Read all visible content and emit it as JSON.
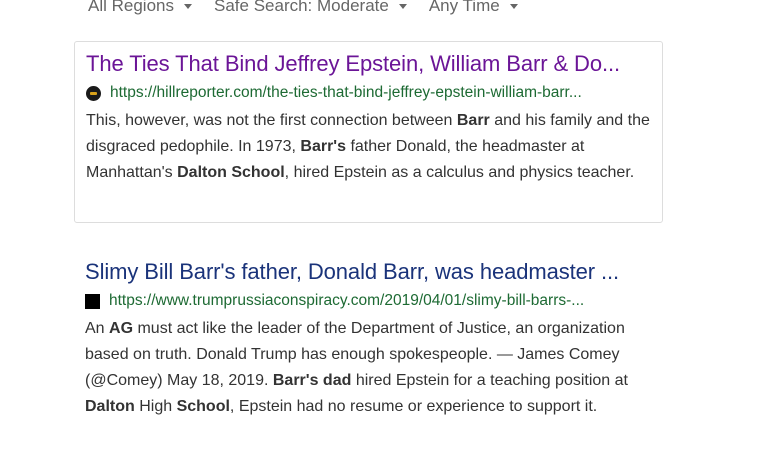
{
  "filters": [
    {
      "label": "All Regions"
    },
    {
      "label": "Safe Search: Moderate"
    },
    {
      "label": "Any Time"
    }
  ],
  "results": [
    {
      "title": "The Ties That Bind Jeffrey Epstein, William Barr & Do...",
      "url": "https://hillreporter.com/the-ties-that-bind-jeffrey-epstein-william-barr...",
      "favicon": "hillreporter-favicon",
      "visited": true,
      "snippet": [
        {
          "t": "This, however, was not the first connection between "
        },
        {
          "t": "Barr",
          "b": true
        },
        {
          "t": " and his family and the disgraced pedophile. In 1973, "
        },
        {
          "t": "Barr's",
          "b": true
        },
        {
          "t": " father Donald, the headmaster at Manhattan's "
        },
        {
          "t": "Dalton School",
          "b": true
        },
        {
          "t": ", hired Epstein as a calculus and physics teacher."
        }
      ]
    },
    {
      "title": "Slimy Bill Barr's father, Donald Barr, was headmaster ...",
      "url": "https://www.trumprussiaconspiracy.com/2019/04/01/slimy-bill-barrs-...",
      "favicon": "trumprussiaconspiracy-favicon",
      "visited": false,
      "snippet": [
        {
          "t": "An "
        },
        {
          "t": "AG",
          "b": true
        },
        {
          "t": " must act like the leader of the Department of Justice, an organization based on truth. Donald Trump has enough spokespeople. — James Comey (@Comey) May 18, 2019. "
        },
        {
          "t": "Barr's dad",
          "b": true
        },
        {
          "t": " hired Epstein for a teaching position at "
        },
        {
          "t": "Dalton",
          "b": true
        },
        {
          "t": " High "
        },
        {
          "t": "School",
          "b": true
        },
        {
          "t": ", Epstein had no resume or experience to support it."
        }
      ]
    }
  ]
}
